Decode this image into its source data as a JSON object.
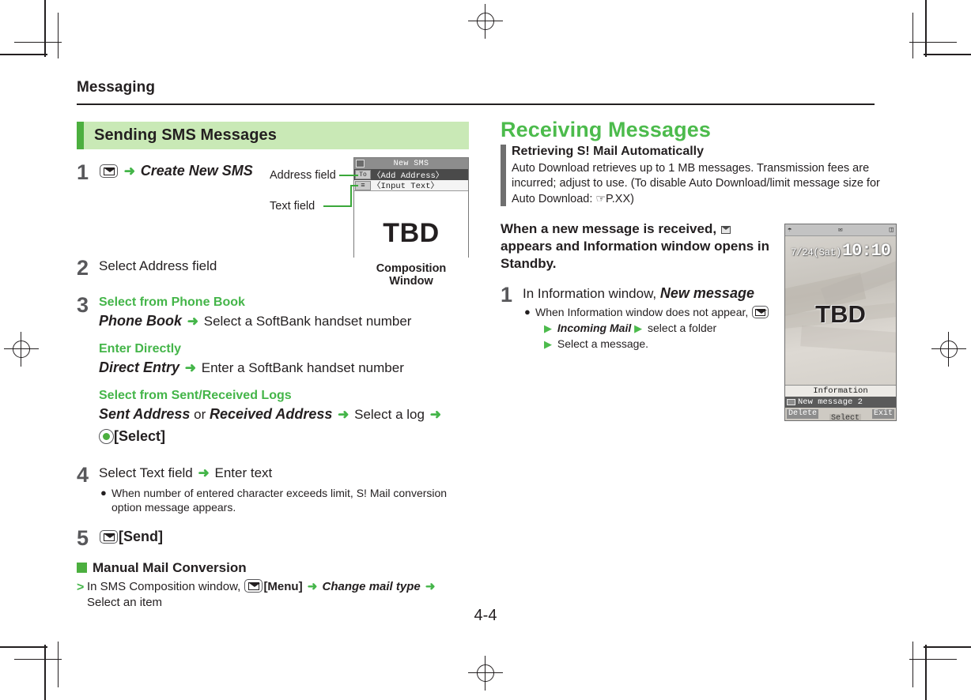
{
  "document": {
    "running_head": "Messaging",
    "page_number": "4-4"
  },
  "left_column": {
    "section_bar": {
      "title": "Sending SMS Messages"
    },
    "steps": [
      {
        "num": "1",
        "key_icon": "mail-key-icon",
        "arrow": "➜",
        "text_italic": "Create New SMS"
      },
      {
        "num": "2",
        "text": "Select Address field"
      },
      {
        "num": "3",
        "groups": [
          {
            "heading": "Select from Phone Book",
            "bold_italic": "Phone Book",
            "arrow": "➜",
            "rest": "Select a SoftBank handset number"
          },
          {
            "heading": "Enter Directly",
            "bold_italic": "Direct Entry",
            "arrow": "➜",
            "rest": "Enter a SoftBank handset number"
          },
          {
            "heading": "Select from Sent/Received Logs",
            "bold_italic": "Sent Address",
            "conj": "or",
            "bold_italic2": "Received Address",
            "arrow": "➜",
            "rest": "Select a log",
            "arrow2": "➜",
            "key_icon": "center-select-key-icon",
            "key_label": "[Select]"
          }
        ]
      },
      {
        "num": "4",
        "text_a": "Select Text field",
        "arrow": "➜",
        "text_b": "Enter text",
        "note": "When number of entered character exceeds limit, S! Mail conversion option message appears."
      },
      {
        "num": "5",
        "key_icon": "mail-key-icon",
        "key_label": "[Send]"
      }
    ],
    "block": {
      "heading": "Manual Mail Conversion",
      "marker": ">",
      "line_a": "In SMS Composition window,",
      "key_icon": "mail-key-icon",
      "key_label": "[Menu]",
      "arrow": "➜",
      "italic": "Change mail type",
      "arrow2": "➜",
      "line_b": "Select an item"
    },
    "callouts": {
      "address_field": "Address field",
      "text_field": "Text field",
      "caption": "Composition Window"
    },
    "composition_window": {
      "title": "New SMS",
      "rows": [
        {
          "tag": "To",
          "value": "〈Add Address〉",
          "selected": true
        },
        {
          "tag": "",
          "value": "〈Input Text〉",
          "selected": false
        }
      ],
      "body_placeholder": "TBD"
    }
  },
  "right_column": {
    "heading": "Receiving Messages",
    "gray_block": {
      "title": "Retrieving S! Mail Automatically",
      "text": "Auto Download retrieves up to 1 MB messages. Transmission fees are incurred; adjust to use. (To disable Auto Download/limit message size for Auto Download:",
      "ref_icon": "pointing-hand-icon",
      "ref": "P.XX)"
    },
    "lead": {
      "part_a": "When a new message is received,",
      "icon": "mail-envelope-icon",
      "part_b": "appears and Information window opens in Standby."
    },
    "step": {
      "num": "1",
      "text": "In Information window,",
      "italic": "New message",
      "note_a": "When Information window does not appear,",
      "key_icon": "mail-key-icon",
      "tri": "▶",
      "note_italic": "Incoming Mail",
      "tri2": "▶",
      "note_b": "select a folder",
      "tri3": "▶",
      "note_c": "Select a message."
    },
    "standby_screen": {
      "status_icons": [
        "signal-icon",
        "mail-icon",
        "battery-icon"
      ],
      "date": "7/24(Sat)",
      "time": "10:10",
      "wallpaper_placeholder": "TBD",
      "info_title": "Information",
      "info_item": "New message 2",
      "softkeys": {
        "left": "Delete",
        "center": "Select",
        "right": "Exit"
      }
    }
  },
  "colors": {
    "green_accent": "#4caf3f",
    "green_bar_bg": "#c9e9b6",
    "green_heading": "#4cbb4c",
    "gray_bar": "#6f6f6f",
    "text": "#231f20"
  }
}
